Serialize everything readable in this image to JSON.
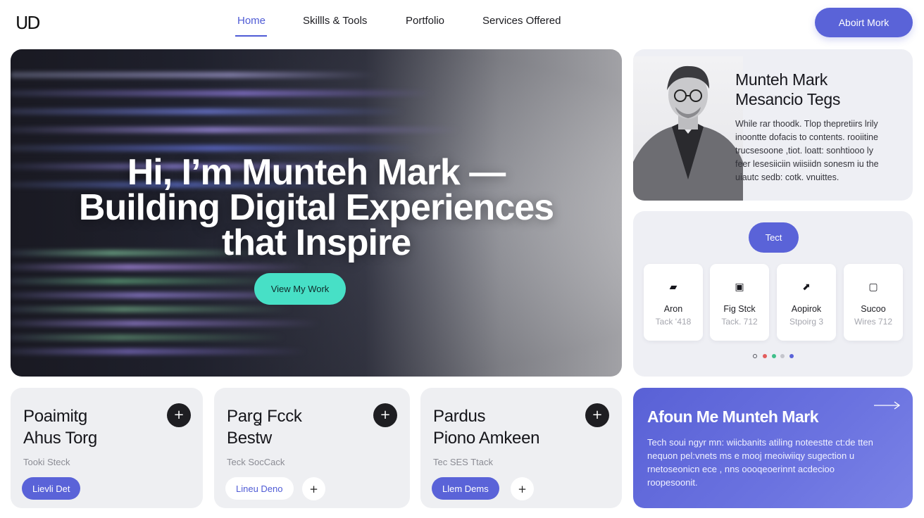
{
  "logo": "UD",
  "nav": {
    "items": [
      "Home",
      "Skillls & Tools",
      "Portfolio",
      "Services Offered"
    ],
    "active": "Home",
    "cta": "Aboirt Mork"
  },
  "hero": {
    "title_lines": [
      "Hi, I’m Munteh Mark —",
      "Building Digital Experiences",
      "that Inspire"
    ],
    "cta": "View My Work"
  },
  "profile": {
    "name_lines": [
      "Munteh Mark",
      "Mesancio Tegs"
    ],
    "bio_lines": [
      "While rar thoodk. Tlop thepretiirs lrily",
      "inoontte dofacis to contents. rooiitine",
      "trucsesoone ,tiot. loatt: sonhtiooo ly",
      "feer lesesiiciin wiisiidn sonesm iu the",
      "uiautc sedb: cotk. vnuittes."
    ]
  },
  "tech": {
    "tag": "Tect",
    "tiles": [
      {
        "icon": "stack-icon",
        "glyph": "▰",
        "name": "Aron",
        "sub": "Tack ʻ418"
      },
      {
        "icon": "document-icon",
        "glyph": "▣",
        "name": "Fig Stck",
        "sub": "Tack. 712"
      },
      {
        "icon": "diagonal-icon",
        "glyph": "⬈",
        "name": "Aopirok",
        "sub": "Stpoirg 3"
      },
      {
        "icon": "frame-icon",
        "glyph": "▢",
        "name": "Sucoo",
        "sub": "Wires 712"
      }
    ],
    "dots": [
      "#9a9ba2",
      "#e25d5d",
      "#3fbf8a",
      "#c4c5cc",
      "#5a63d8"
    ]
  },
  "projects": [
    {
      "title_lines": [
        "Poaimitg",
        "Ahus  Torg"
      ],
      "tag": "Tooki Steck",
      "button": "Lievli Det",
      "button_style": "filled",
      "has_mini": false
    },
    {
      "title_lines": [
        "Parꬶ Fcck",
        "Bestw"
      ],
      "tag": "Teck SocCack",
      "button": "Lineu Deno",
      "button_style": "outline",
      "has_mini": true
    },
    {
      "title_lines": [
        "Pardus",
        "Piono Amkeen"
      ],
      "tag": "Tec SES Ttack",
      "button": "Llem Dems",
      "button_style": "filled",
      "has_mini": true
    }
  ],
  "about": {
    "title": "Afoun Me Munteh Mark",
    "text_lines": [
      "Tech soui ngyr mn: wiicbanits atiling noteestte ct:de tten",
      "nequon pel:vnets ms e mooj rneoiwiiqy sugection u",
      "rnetoseonicn ece , nns oooqeoerinnt acdecioo",
      "roopesoonit."
    ]
  },
  "colors": {
    "accent": "#5a63d8",
    "teal": "#47e0c6",
    "card": "#eeeff4"
  }
}
